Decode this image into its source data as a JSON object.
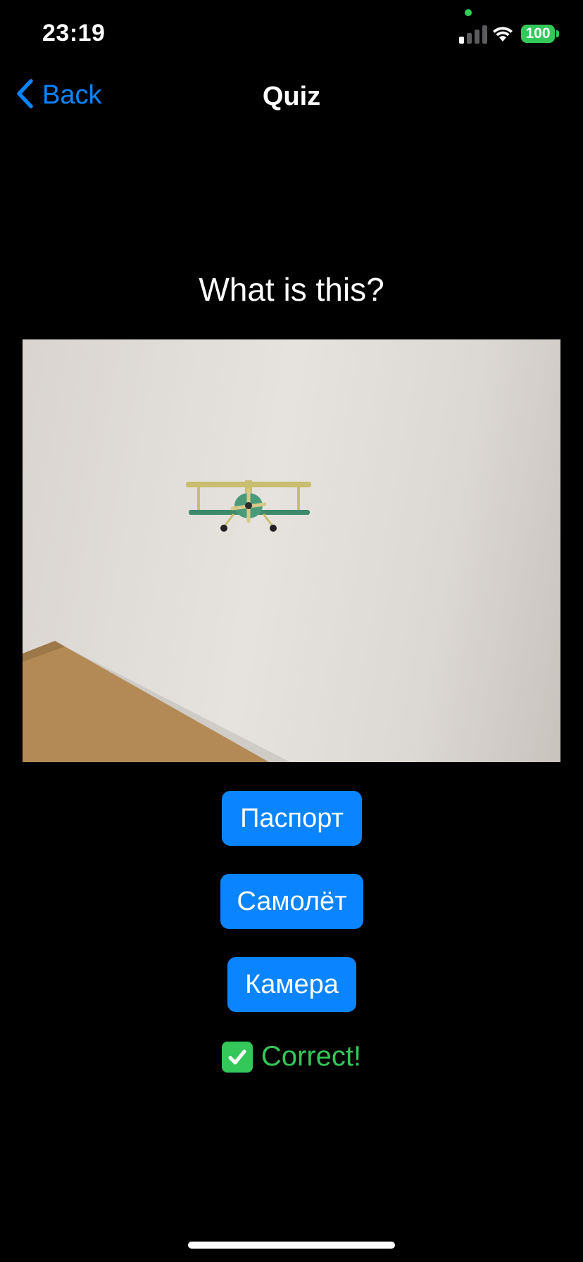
{
  "status_bar": {
    "time": "23:19",
    "battery": "100",
    "icons": [
      "signal-icon",
      "wifi-icon",
      "battery-icon"
    ]
  },
  "nav": {
    "back_label": "Back",
    "title": "Quiz"
  },
  "quiz": {
    "question": "What is this?",
    "photo_subject": "toy-biplane-photo",
    "answers": [
      "Паспорт",
      "Самолёт",
      "Камера"
    ],
    "feedback": {
      "icon": "check-mark-icon",
      "text": "Correct!"
    }
  },
  "colors": {
    "background": "#000000",
    "accent": "#0a84ff",
    "success": "#34c759",
    "text": "#ffffff"
  }
}
